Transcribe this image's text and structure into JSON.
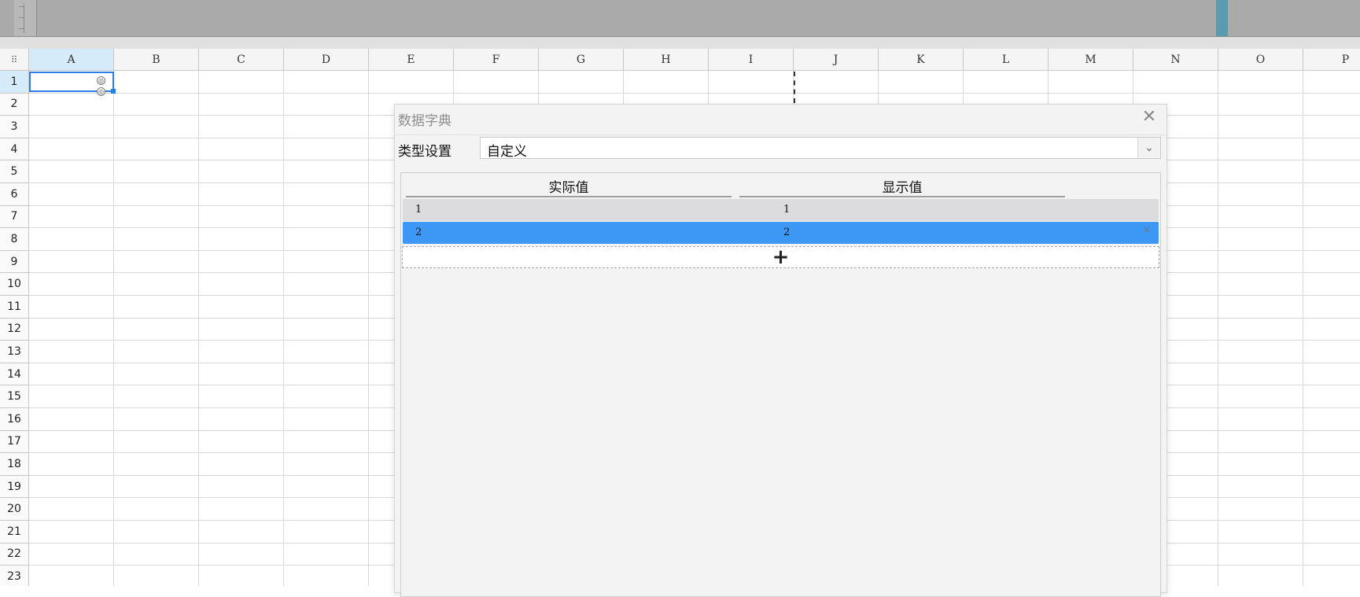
{
  "columns": [
    "A",
    "B",
    "C",
    "D",
    "E",
    "F",
    "G",
    "H",
    "I",
    "J",
    "K",
    "L",
    "M",
    "N",
    "O",
    "P"
  ],
  "rows": [
    "1",
    "2",
    "3",
    "4",
    "5",
    "6",
    "7",
    "8",
    "9",
    "10",
    "11",
    "12",
    "13",
    "14",
    "15",
    "16",
    "17",
    "18",
    "19",
    "20",
    "21",
    "22",
    "23"
  ],
  "selected_cell": "A1",
  "dialog": {
    "title": "数据字典",
    "close_icon": "close-icon",
    "type_label": "类型设置",
    "type_value": "自定义",
    "table_headers": [
      "实际值",
      "显示值"
    ],
    "entries": [
      {
        "actual": "1",
        "display": "1",
        "selected": false
      },
      {
        "actual": "2",
        "display": "2",
        "selected": true
      }
    ],
    "add_icon": "plus-icon"
  },
  "colors": {
    "selection": "#3d98f5",
    "active_border": "#2b7de9",
    "header_highlight": "#d6ebfa"
  }
}
